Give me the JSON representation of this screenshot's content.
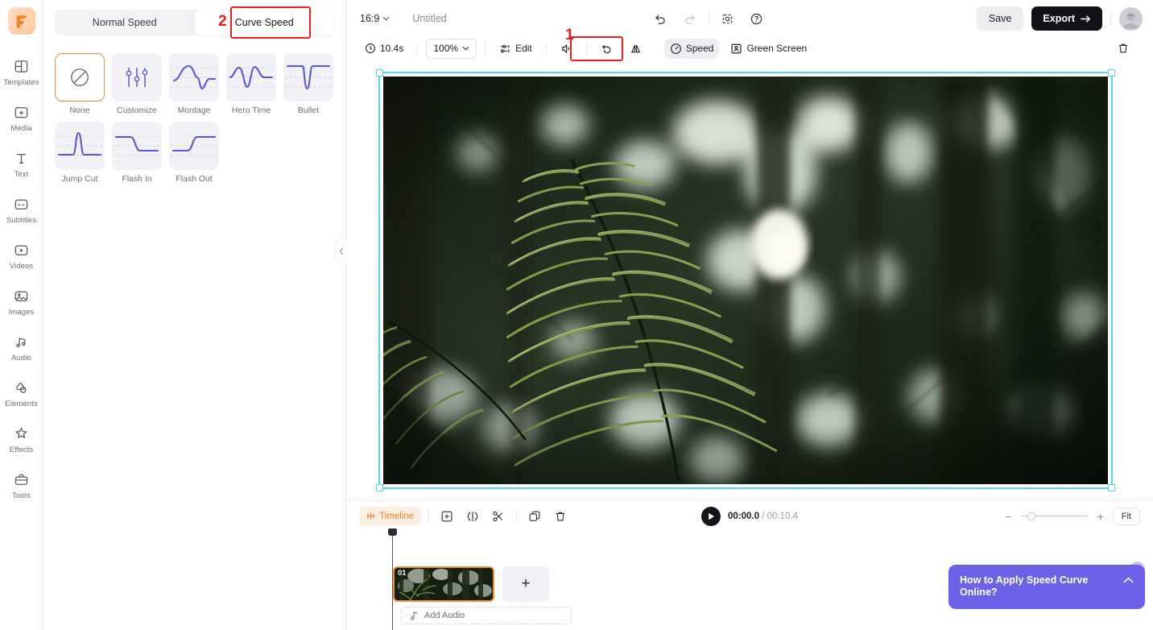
{
  "brand": {
    "logo_icon": "flexclip-f-logo",
    "accent": "#f2832c",
    "selection": "#55d5f0",
    "annotation": "#ee1d25"
  },
  "sidebar": {
    "items": [
      {
        "label": "Templates",
        "icon": "templates-icon"
      },
      {
        "label": "Media",
        "icon": "media-add-icon"
      },
      {
        "label": "Text",
        "icon": "text-icon"
      },
      {
        "label": "Subtitles",
        "icon": "subtitles-icon"
      },
      {
        "label": "Videos",
        "icon": "videos-play-icon"
      },
      {
        "label": "Images",
        "icon": "images-icon"
      },
      {
        "label": "Audio",
        "icon": "audio-note-icon"
      },
      {
        "label": "Elements",
        "icon": "elements-shapes-icon"
      },
      {
        "label": "Effects",
        "icon": "effects-sparkle-icon"
      },
      {
        "label": "Tools",
        "icon": "tools-briefcase-icon"
      }
    ]
  },
  "speed_panel": {
    "tabs": [
      {
        "label": "Normal Speed",
        "active": false
      },
      {
        "label": "Curve Speed",
        "active": true
      }
    ],
    "annotation_number": "2",
    "presets": [
      {
        "label": "None",
        "icon": "no-curve-icon",
        "selected": true
      },
      {
        "label": "Customize",
        "icon": "sliders-icon",
        "selected": false
      },
      {
        "label": "Montage",
        "icon": "montage-curve-icon",
        "selected": false
      },
      {
        "label": "Hero Time",
        "icon": "hero-time-curve-icon",
        "selected": false
      },
      {
        "label": "Bullet",
        "icon": "bullet-curve-icon",
        "selected": false
      },
      {
        "label": "Jump Cut",
        "icon": "jump-cut-curve-icon",
        "selected": false
      },
      {
        "label": "Flash In",
        "icon": "flash-in-curve-icon",
        "selected": false
      },
      {
        "label": "Flash Out",
        "icon": "flash-out-curve-icon",
        "selected": false
      }
    ],
    "collapse_icon": "chevron-left-icon"
  },
  "topbar": {
    "ratio": "16:9",
    "ratio_caret_icon": "chevron-down-icon",
    "project_title": "Untitled",
    "undo_icon": "undo-icon",
    "redo_icon": "redo-icon",
    "autosave_icon": "cloud-sync-icon",
    "help_icon": "help-circle-icon",
    "save_label": "Save",
    "export_label": "Export",
    "export_arrow_icon": "arrow-right-icon",
    "avatar_icon": "user-avatar"
  },
  "actionbar": {
    "duration": "10.4s",
    "duration_icon": "clock-icon",
    "zoom_value": "100%",
    "zoom_caret_icon": "chevron-down-icon",
    "edit_label": "Edit",
    "edit_icon": "adjust-sliders-icon",
    "volume_icon": "volume-icon",
    "rotate_icon": "rotate-left-icon",
    "flip_icon": "flip-horizontal-icon",
    "speed_label": "Speed",
    "speed_icon": "speedometer-icon",
    "speed_annotation_number": "1",
    "greenscreen_label": "Green Screen",
    "greenscreen_icon": "green-screen-person-icon",
    "delete_icon": "trash-icon"
  },
  "preview": {
    "alt": "Backlit fern frond in a sunlit forest with bokeh highlights",
    "selected": true
  },
  "timeline": {
    "tag_label": "Timeline",
    "tag_icon": "timeline-icon",
    "tools": [
      {
        "icon": "add-media-icon",
        "name": "add-media-button"
      },
      {
        "icon": "split-transition-icon",
        "name": "transition-button"
      },
      {
        "icon": "scissors-icon",
        "name": "split-button"
      },
      {
        "icon": "duplicate-icon",
        "name": "duplicate-button"
      },
      {
        "icon": "trash-icon",
        "name": "delete-button"
      }
    ],
    "play_icon": "play-icon",
    "current_time": "00:00.0",
    "time_separator": "/",
    "total_time": "00:10.4",
    "zoom_out_icon": "minus-icon",
    "zoom_in_icon": "plus-icon",
    "fit_label": "Fit",
    "clips": [
      {
        "number": "01"
      }
    ],
    "add_clip_icon": "plus-icon",
    "add_audio_label": "Add Audio",
    "add_audio_icon": "music-note-icon"
  },
  "banner": {
    "title": "How to Apply Speed Curve Online?",
    "collapse_icon": "chevron-up-icon",
    "close_icon": "close-icon",
    "color": "#6c62ea"
  }
}
